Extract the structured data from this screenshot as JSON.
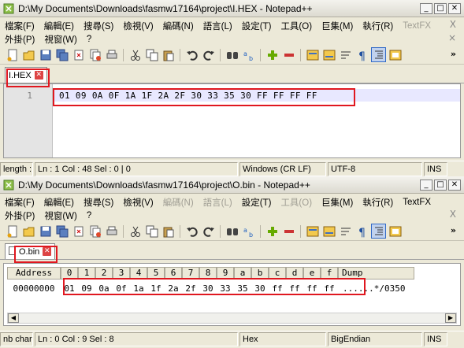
{
  "window1": {
    "title": "D:\\My Documents\\Downloads\\fasmw17164\\project\\I.HEX - Notepad++",
    "menu_row1": [
      "檔案(F)",
      "編輯(E)",
      "搜尋(S)",
      "檢視(V)",
      "編碼(N)",
      "語言(L)",
      "設定(T)",
      "工具(O)",
      "巨集(M)",
      "執行(R)",
      "TextFX"
    ],
    "menu_row2": [
      "外掛(P)",
      "視窗(W)",
      "?"
    ],
    "menu_close": "X",
    "tab_label": "I.HEX",
    "line_number": "1",
    "content": "01 09 0A 0F 1A 1F 2A 2F 30 33 35 30 FF FF FF FF",
    "status": {
      "length": "length :",
      "position": "Ln : 1    Col : 48    Sel : 0 | 0",
      "eol": "Windows (CR LF)",
      "encoding": "UTF-8",
      "mode": "INS"
    }
  },
  "window2": {
    "title": "D:\\My Documents\\Downloads\\fasmw17164\\project\\O.bin - Notepad++",
    "menu_row1": [
      "檔案(F)",
      "編輯(E)",
      "搜尋(S)",
      "檢視(V)",
      "編碼(N)",
      "語言(L)",
      "設定(T)",
      "工具(O)",
      "巨集(M)",
      "執行(R)",
      "TextFX"
    ],
    "menu_row2": [
      "外掛(P)",
      "視窗(W)",
      "?"
    ],
    "menu_close": "X",
    "tab_label": "O.bin",
    "hex_header": {
      "address": "Address",
      "columns": [
        "0",
        "1",
        "2",
        "3",
        "4",
        "5",
        "6",
        "7",
        "8",
        "9",
        "a",
        "b",
        "c",
        "d",
        "e",
        "f"
      ],
      "dump": "Dump"
    },
    "hex_row": {
      "address": "00000000",
      "bytes": [
        "01",
        "09",
        "0a",
        "0f",
        "1a",
        "1f",
        "2a",
        "2f",
        "30",
        "33",
        "35",
        "30",
        "ff",
        "ff",
        "ff",
        "ff"
      ],
      "dump": "......*/0350"
    },
    "status": {
      "length": "nb char",
      "position": "Ln : 0    Col : 9    Sel : 8",
      "eol": "Hex",
      "encoding": "BigEndian",
      "mode": "INS"
    }
  },
  "colors": {
    "highlight_box": "#e0171f",
    "current_line": "#e8e8ff"
  }
}
